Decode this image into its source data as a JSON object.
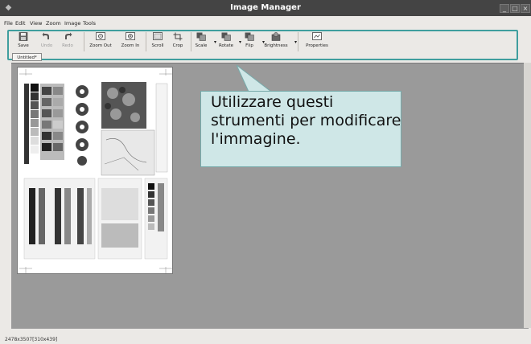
{
  "window": {
    "title": "Image Manager",
    "app_icon": "app-icon"
  },
  "menu": [
    "File",
    "Edit",
    "View",
    "Zoom",
    "Image",
    "Tools"
  ],
  "toolbar": {
    "buttons": [
      {
        "label": "Save",
        "icon": "save-icon",
        "enabled": true
      },
      {
        "label": "Undo",
        "icon": "undo-icon",
        "enabled": false
      },
      {
        "label": "Redo",
        "icon": "redo-icon",
        "enabled": false
      },
      {
        "label": "Zoom Out",
        "icon": "zoom-out-icon",
        "enabled": true
      },
      {
        "label": "Zoom In",
        "icon": "zoom-in-icon",
        "enabled": true
      },
      {
        "label": "Scroll",
        "icon": "scroll-icon",
        "enabled": true
      },
      {
        "label": "Crop",
        "icon": "crop-icon",
        "enabled": true
      },
      {
        "label": "Scale",
        "icon": "scale-icon",
        "enabled": true
      },
      {
        "label": "Rotate",
        "icon": "rotate-icon",
        "enabled": true
      },
      {
        "label": "Flip",
        "icon": "flip-icon",
        "enabled": true
      },
      {
        "label": "Brightness",
        "icon": "brightness-icon",
        "enabled": true
      },
      {
        "label": "Properties",
        "icon": "properties-icon",
        "enabled": true
      }
    ]
  },
  "tab": {
    "label": "Untitled*"
  },
  "status": {
    "text": "2478x3507[310x439]"
  },
  "callout": {
    "text": "Utilizzare questi strumenti per modificare l'immagine."
  },
  "colors": {
    "highlight": "#3f9e9e",
    "callout_bg": "#cfe7e7",
    "canvas": "#9a9a9a",
    "titlebar": "#444444"
  }
}
